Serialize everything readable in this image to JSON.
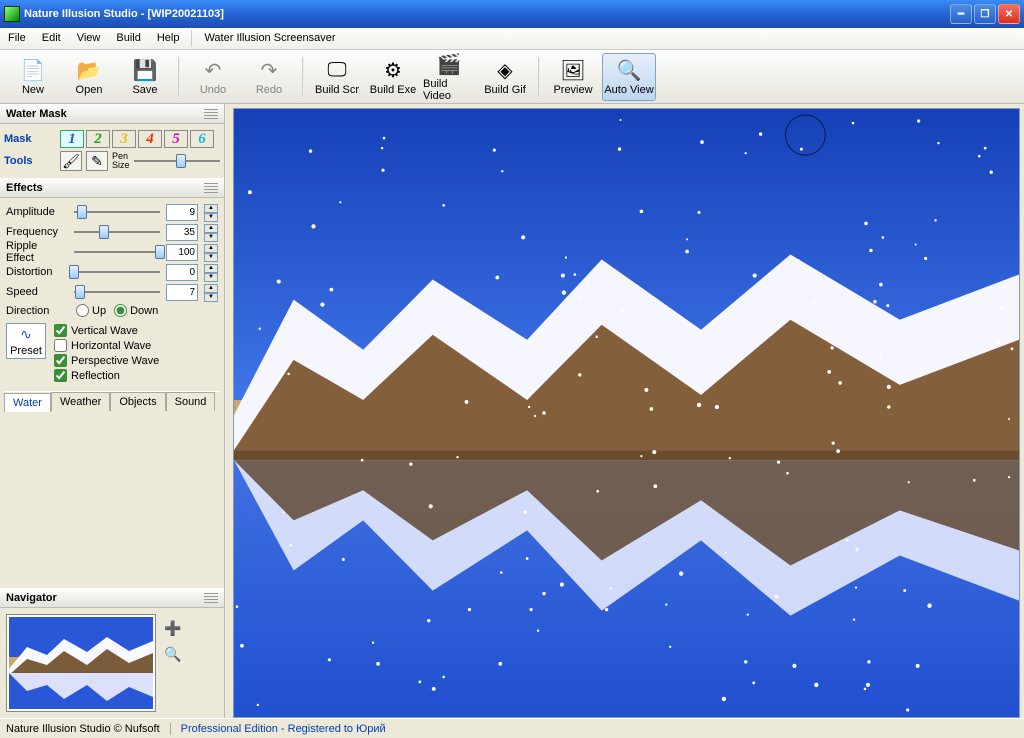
{
  "title": "Nature Illusion Studio  -  [WIP20021103]",
  "menu": [
    "File",
    "Edit",
    "View",
    "Build",
    "Help"
  ],
  "menu_extra": "Water Illusion Screensaver",
  "toolbar": [
    {
      "id": "new",
      "label": "New",
      "icon": "📄"
    },
    {
      "id": "open",
      "label": "Open",
      "icon": "📂"
    },
    {
      "id": "save",
      "label": "Save",
      "icon": "💾"
    },
    {
      "sep": true
    },
    {
      "id": "undo",
      "label": "Undo",
      "icon": "↶",
      "disabled": true
    },
    {
      "id": "redo",
      "label": "Redo",
      "icon": "↷",
      "disabled": true
    },
    {
      "sep": true
    },
    {
      "id": "buildscr",
      "label": "Build Scr",
      "icon": "🖵"
    },
    {
      "id": "buildexe",
      "label": "Build Exe",
      "icon": "⚙"
    },
    {
      "id": "buildvideo",
      "label": "Build Video",
      "icon": "🎬"
    },
    {
      "id": "buildgif",
      "label": "Build Gif",
      "icon": "◈"
    },
    {
      "sep": true
    },
    {
      "id": "preview",
      "label": "Preview",
      "icon": "🖼"
    },
    {
      "id": "autoview",
      "label": "Auto View",
      "icon": "🔍",
      "active": true
    }
  ],
  "panel_watermask": "Water Mask",
  "mask_label": "Mask",
  "tools_label": "Tools",
  "mask_numbers": [
    "1",
    "2",
    "3",
    "4",
    "5",
    "6"
  ],
  "mask_colors": [
    "#2a52e0",
    "#1aa41a",
    "#e0c116",
    "#e73210",
    "#c111c1",
    "#16b4e0"
  ],
  "pen_size_label": "Pen\nSize",
  "panel_effects": "Effects",
  "effects": {
    "amplitude": {
      "label": "Amplitude",
      "value": 9,
      "max": 100
    },
    "frequency": {
      "label": "Frequency",
      "value": 35,
      "max": 100
    },
    "ripple": {
      "label": "Ripple Effect",
      "value": 100,
      "max": 100
    },
    "distortion": {
      "label": "Distortion",
      "value": 0,
      "max": 100
    },
    "speed": {
      "label": "Speed",
      "value": 7,
      "max": 100
    }
  },
  "direction": {
    "label": "Direction",
    "up": "Up",
    "down": "Down",
    "value": "down"
  },
  "checks": {
    "vertical": {
      "label": "Vertical Wave",
      "checked": true
    },
    "horizontal": {
      "label": "Horizontal Wave",
      "checked": false
    },
    "perspective": {
      "label": "Perspective Wave",
      "checked": true
    },
    "reflection": {
      "label": "Reflection",
      "checked": true
    }
  },
  "preset_label": "Preset",
  "tabs": [
    "Water",
    "Weather",
    "Objects",
    "Sound"
  ],
  "active_tab": 0,
  "panel_navigator": "Navigator",
  "status_left": "Nature Illusion Studio © Nufsoft",
  "status_right": "Professional Edition - Registered to Юрий"
}
